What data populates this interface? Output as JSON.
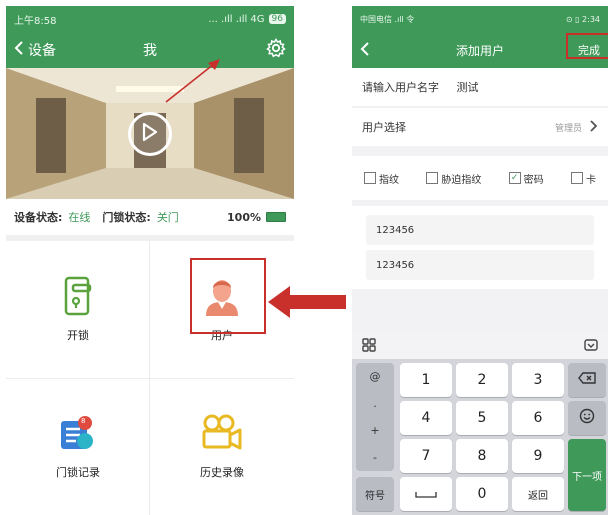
{
  "left": {
    "status_time": "上午8:58",
    "status_icons": "... .ıll .ıll 4G",
    "battery": "96",
    "title": "我",
    "back_label": "设备",
    "device_status_label": "设备状态:",
    "device_status_value": "在线",
    "lock_status_label": "门锁状态:",
    "lock_status_value": "关门",
    "battery_level": "100%",
    "tiles": [
      {
        "label": "开锁",
        "icon": "unlock-icon"
      },
      {
        "label": "用户",
        "icon": "user-avatar-icon"
      },
      {
        "label": "门锁记录",
        "icon": "lock-record-icon",
        "badge": "8"
      },
      {
        "label": "历史录像",
        "icon": "video-camera-icon"
      }
    ]
  },
  "right": {
    "status_left": "中国电信 .ıll 令",
    "status_right": "⊙ ▯ 2:34",
    "title": "添加用户",
    "done_label": "完成",
    "name_label": "请输入用户名字",
    "name_value": "测试",
    "user_select_label": "用户选择",
    "user_select_value": "管理员",
    "checks": [
      {
        "label": "指纹",
        "checked": false
      },
      {
        "label": "胁迫指纹",
        "checked": false
      },
      {
        "label": "密码",
        "checked": true
      },
      {
        "label": "卡",
        "checked": false
      }
    ],
    "password": "123456",
    "password_confirm": "123456",
    "keyboard": {
      "symbols": [
        "@",
        ".",
        "+",
        "-"
      ],
      "digits": [
        "1",
        "2",
        "3",
        "4",
        "5",
        "6",
        "7",
        "8",
        "9"
      ],
      "zero": "0",
      "sym_key": "符号",
      "return_key": "返回",
      "next_key": "下一项"
    }
  },
  "accent_color": "#3f9a5a",
  "highlight_color": "#c9302c"
}
